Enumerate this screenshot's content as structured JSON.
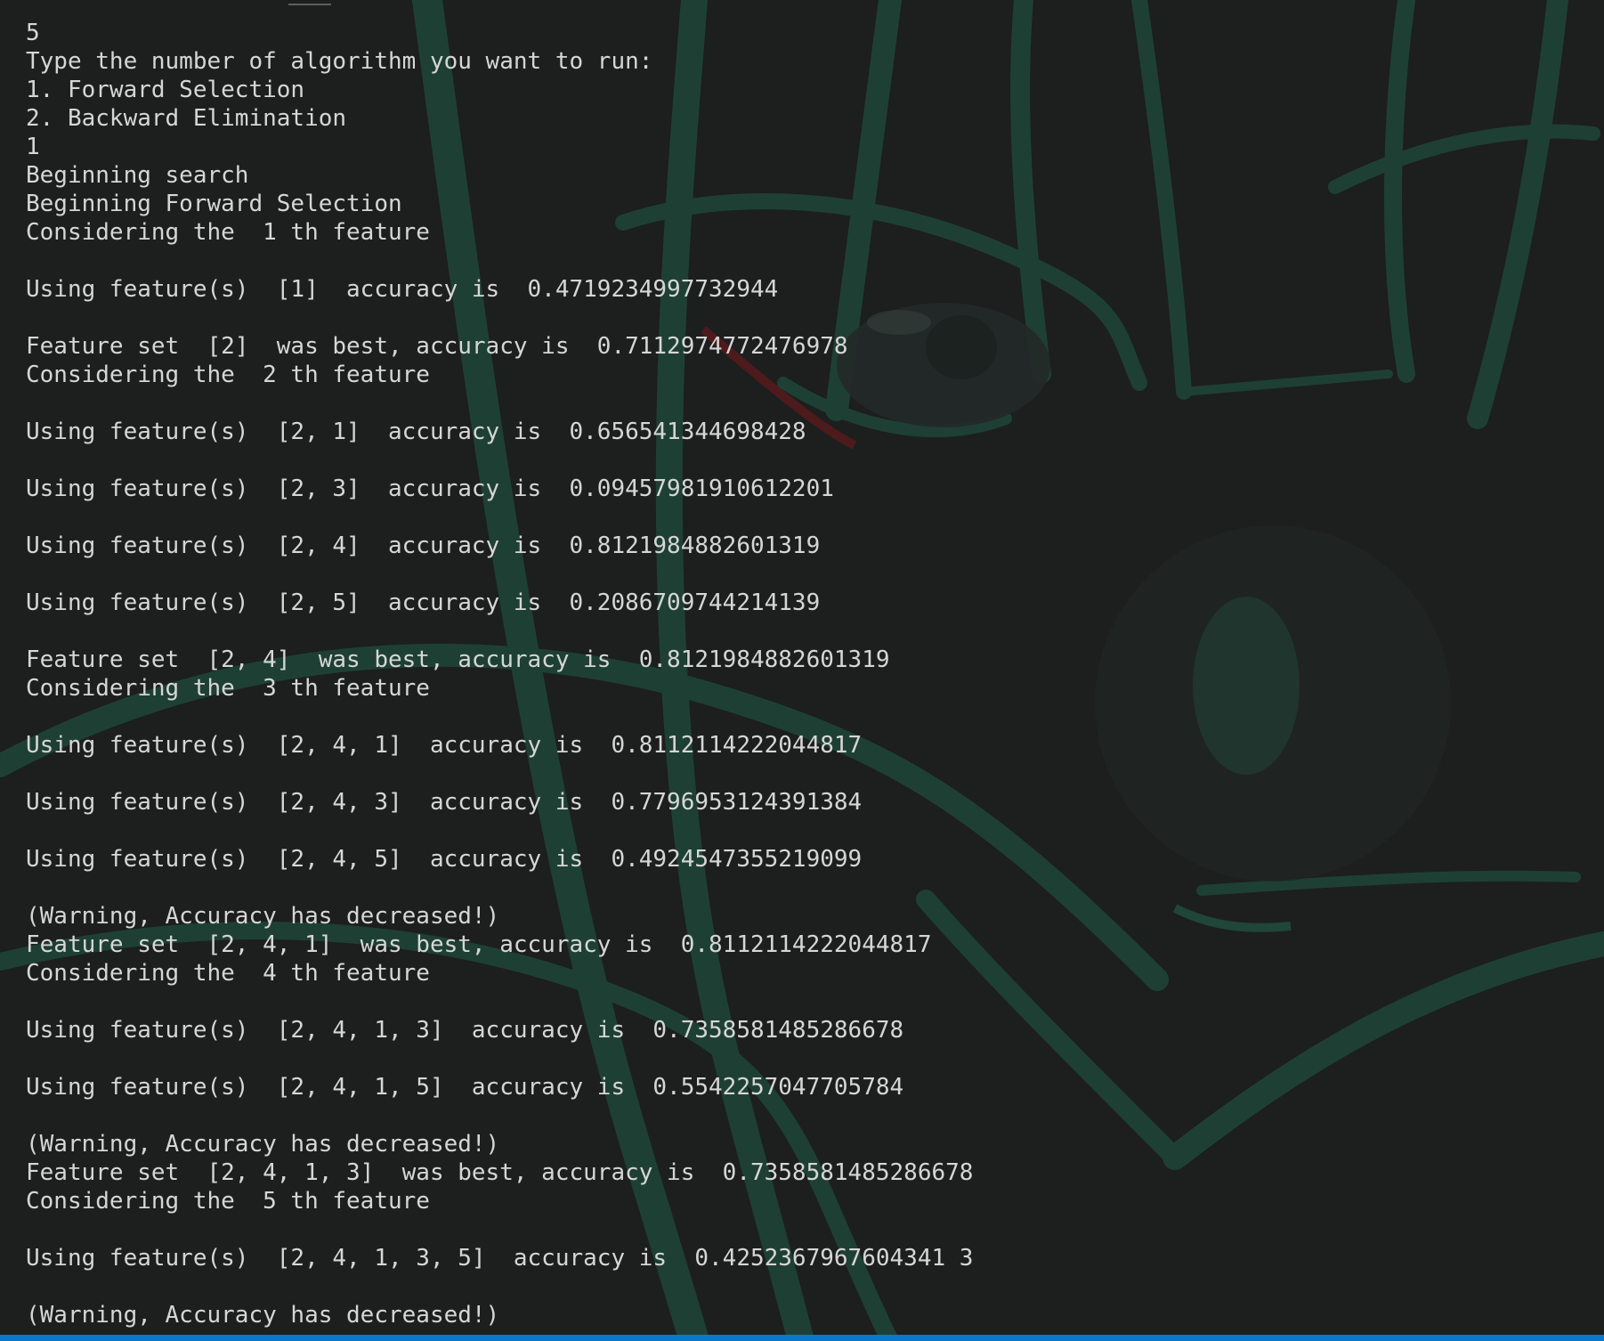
{
  "terminal": {
    "lines": [
      "5",
      "Type the number of algorithm you want to run:",
      "1. Forward Selection",
      "2. Backward Elimination",
      "1",
      "Beginning search",
      "Beginning Forward Selection",
      "Considering the  1 th feature",
      "",
      "Using feature(s)  [1]  accuracy is  0.4719234997732944",
      "",
      "Feature set  [2]  was best, accuracy is  0.7112974772476978",
      "Considering the  2 th feature",
      "",
      "Using feature(s)  [2, 1]  accuracy is  0.656541344698428",
      "",
      "Using feature(s)  [2, 3]  accuracy is  0.09457981910612201",
      "",
      "Using feature(s)  [2, 4]  accuracy is  0.8121984882601319",
      "",
      "Using feature(s)  [2, 5]  accuracy is  0.2086709744214139",
      "",
      "Feature set  [2, 4]  was best, accuracy is  0.8121984882601319",
      "Considering the  3 th feature",
      "",
      "Using feature(s)  [2, 4, 1]  accuracy is  0.8112114222044817",
      "",
      "Using feature(s)  [2, 4, 3]  accuracy is  0.7796953124391384",
      "",
      "Using feature(s)  [2, 4, 5]  accuracy is  0.4924547355219099",
      "",
      "(Warning, Accuracy has decreased!)",
      "Feature set  [2, 4, 1]  was best, accuracy is  0.8112114222044817",
      "Considering the  4 th feature",
      "",
      "Using feature(s)  [2, 4, 1, 3]  accuracy is  0.7358581485286678",
      "",
      "Using feature(s)  [2, 4, 1, 5]  accuracy is  0.5542257047705784",
      "",
      "(Warning, Accuracy has decreased!)",
      "Feature set  [2, 4, 1, 3]  was best, accuracy is  0.7358581485286678",
      "Considering the  5 th feature",
      "",
      "Using feature(s)  [2, 4, 1, 3, 5]  accuracy is  0.4252367967604341 3",
      "",
      "(Warning, Accuracy has decreased!)"
    ]
  },
  "colors": {
    "background": "#1d1e1e",
    "text": "#d6d6d6",
    "wallpaper_accent": "#1f4a3c",
    "status_strip": "#0a78c8"
  }
}
